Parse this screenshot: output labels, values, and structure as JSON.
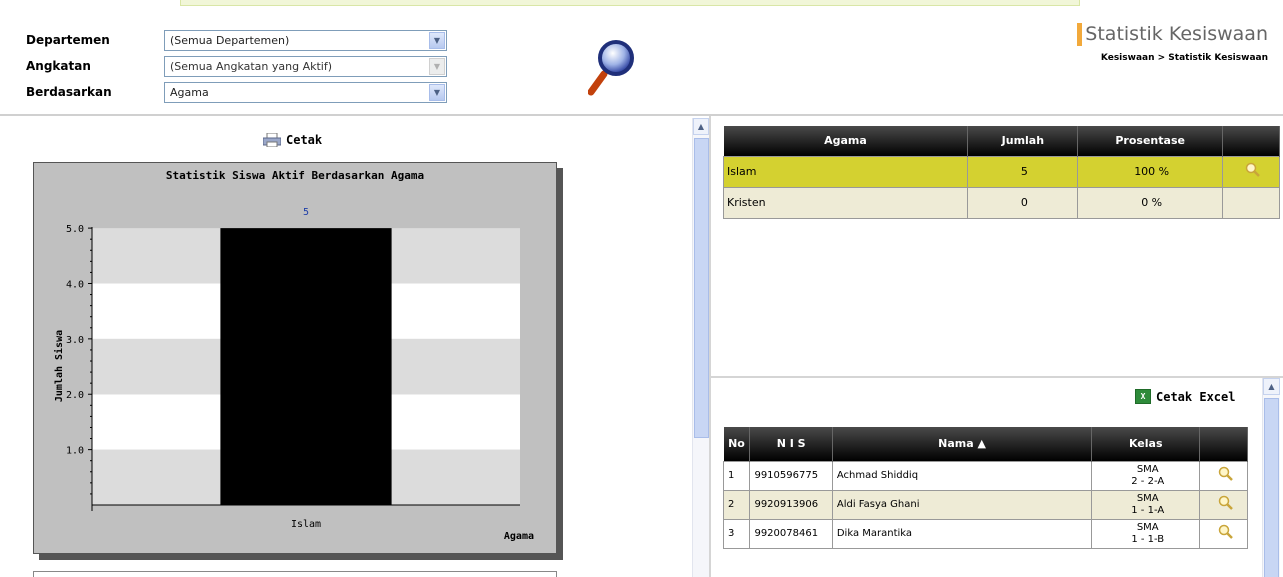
{
  "filter": {
    "departemen_label": "Departemen",
    "departemen_value": "(Semua Departemen)",
    "angkatan_label": "Angkatan",
    "angkatan_value": "(Semua Angkatan yang Aktif)",
    "berdasarkan_label": "Berdasarkan",
    "berdasarkan_value": "Agama"
  },
  "header": {
    "title": "Statistik Kesiswaan",
    "breadcrumb": "Kesiswaan > Statistik Kesiswaan"
  },
  "left": {
    "print_label": "Cetak"
  },
  "chart_data": {
    "type": "bar",
    "title": "Statistik Siswa Aktif Berdasarkan Agama",
    "categories": [
      "Islam"
    ],
    "values": [
      5
    ],
    "data_labels": [
      "5"
    ],
    "xlabel": "Agama",
    "ylabel": "Jumlah Siswa",
    "ylim": [
      0,
      5
    ],
    "yticks": [
      "5.0",
      "4.0",
      "3.0",
      "2.0",
      "1.0"
    ],
    "bar_color": "#000000",
    "grid": true
  },
  "stats_table": {
    "headers": [
      "Agama",
      "Jumlah",
      "Prosentase",
      ""
    ],
    "rows": [
      {
        "agama": "Islam",
        "jumlah": "5",
        "prosentase": "100 %"
      },
      {
        "agama": "Kristen",
        "jumlah": "0",
        "prosentase": "0 %"
      }
    ]
  },
  "student_list": {
    "excel_label": "Cetak Excel",
    "headers": {
      "no": "No",
      "nis": "N I S",
      "nama": "Nama",
      "kelas": "Kelas"
    },
    "rows": [
      {
        "no": "1",
        "nis": "9910596775",
        "nama": "Achmad Shiddiq",
        "kelas_1": "SMA",
        "kelas_2": "2 - 2-A"
      },
      {
        "no": "2",
        "nis": "9920913906",
        "nama": "Aldi Fasya Ghani",
        "kelas_1": "SMA",
        "kelas_2": "1 - 1-A"
      },
      {
        "no": "3",
        "nis": "9920078461",
        "nama": "Dika Marantika",
        "kelas_1": "SMA",
        "kelas_2": "1 - 1-B"
      }
    ]
  },
  "colors": {
    "highlight_row": "#d4d130",
    "alt_row": "#eeebd6",
    "title_accent": "#f2a93b"
  }
}
